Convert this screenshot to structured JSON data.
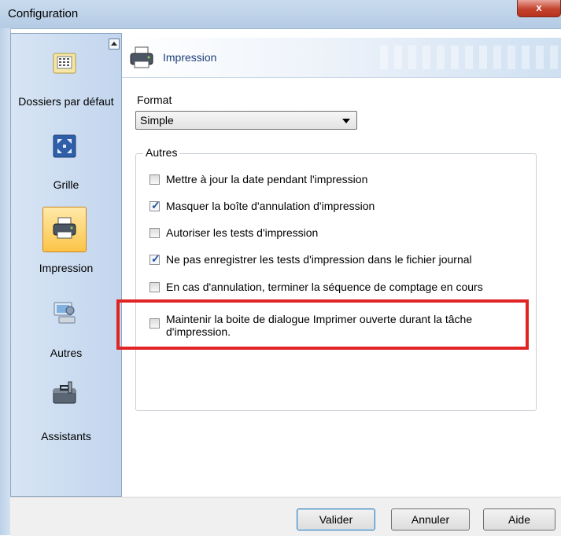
{
  "window": {
    "title": "Configuration",
    "close_glyph": "x"
  },
  "sidebar": {
    "scroll_up_label": "",
    "items": [
      {
        "label": "Dossiers par défaut",
        "icon": "folder-grid-icon",
        "selected": false
      },
      {
        "label": "Grille",
        "icon": "grid-icon",
        "selected": false
      },
      {
        "label": "Impression",
        "icon": "printer-icon",
        "selected": true
      },
      {
        "label": "Autres",
        "icon": "computer-settings-icon",
        "selected": false
      },
      {
        "label": "Assistants",
        "icon": "toolbox-icon",
        "selected": false
      }
    ]
  },
  "header": {
    "title": "Impression",
    "icon": "printer-icon"
  },
  "format": {
    "label": "Format",
    "value": "Simple"
  },
  "group": {
    "legend": "Autres",
    "options": [
      {
        "label": "Mettre à jour la date pendant l'impression",
        "checked": false
      },
      {
        "label": "Masquer la boîte d'annulation d'impression",
        "checked": true
      },
      {
        "label": "Autoriser les tests d'impression",
        "checked": false
      },
      {
        "label": "Ne pas enregistrer les tests d'impression dans le fichier journal",
        "checked": true
      },
      {
        "label": "En cas d'annulation, terminer la séquence de comptage en cours",
        "checked": false
      },
      {
        "label_line1": "Maintenir la boite de dialogue Imprimer ouverte durant la tâche",
        "label_line2": "d'impression.",
        "checked": false
      }
    ]
  },
  "buttons": {
    "ok": "Valider",
    "cancel": "Annuler",
    "help": "Aide"
  },
  "colors": {
    "highlight": "#e02424",
    "selected_bg": "#fcc447",
    "header_text": "#1c3f7a"
  }
}
